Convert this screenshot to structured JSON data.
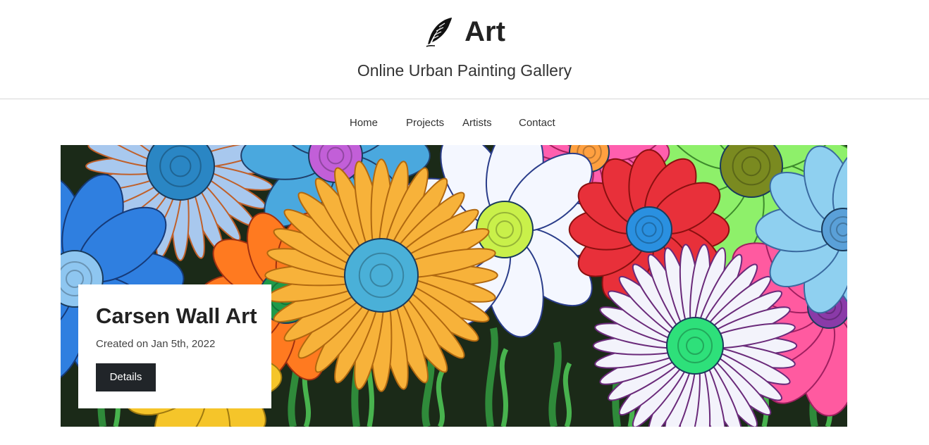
{
  "header": {
    "brand_icon": "quill-feather-icon",
    "brand_name": "Art",
    "tagline": "Online Urban Painting Gallery"
  },
  "nav": {
    "items": [
      {
        "label": "Home"
      },
      {
        "label": "Projects"
      },
      {
        "label": "Artists"
      },
      {
        "label": "Contact"
      }
    ]
  },
  "hero": {
    "image_subject": "colorful painted flower mural",
    "card": {
      "title": "Carsen Wall Art",
      "date": "Created on Jan 5th, 2022",
      "button_label": "Details"
    }
  },
  "colors": {
    "text_dark": "#212529",
    "button_bg": "#212529",
    "button_text": "#ffffff",
    "divider": "#d6d6d6"
  }
}
